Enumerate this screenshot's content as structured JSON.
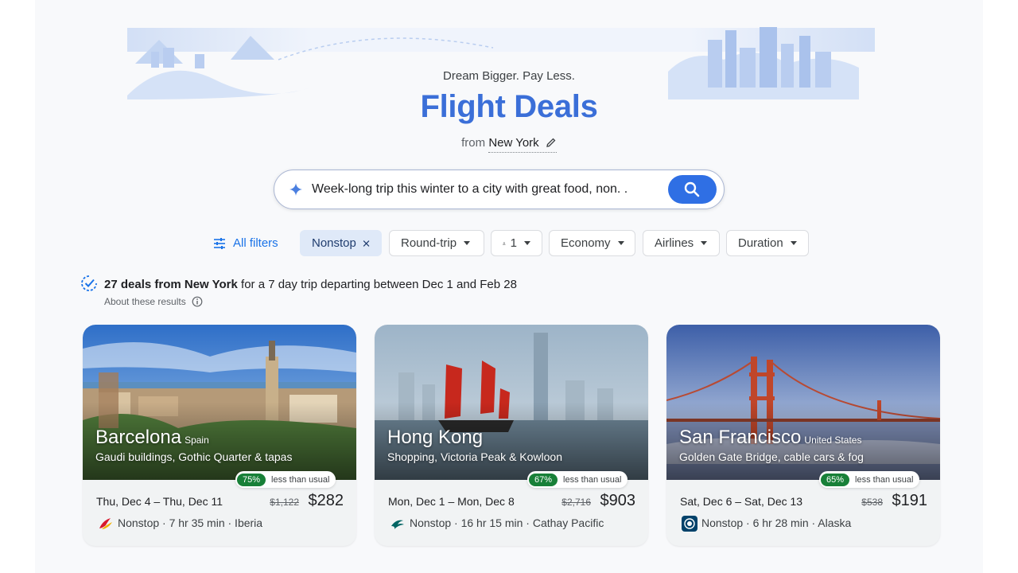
{
  "header": {
    "tagline": "Dream Bigger. Pay Less.",
    "title": "Flight Deals",
    "origin_prefix": "from",
    "origin_city": "New York"
  },
  "search": {
    "query": "Week-long trip this winter to a city with great food, non. ."
  },
  "filters": {
    "all_filters": "All filters",
    "nonstop": "Nonstop",
    "trip_type": "Round-trip",
    "passengers": "1",
    "cabin": "Economy",
    "airlines": "Airlines",
    "duration": "Duration"
  },
  "summary": {
    "count_text": "27 deals from New York",
    "detail_text": " for a 7 day trip departing between Dec 1 and Feb 28",
    "about": "About these results"
  },
  "colors": {
    "accent": "#2f6fe4",
    "title": "#3b6fd8",
    "deal_green": "#188038",
    "chip_selected": "#dfe9f8"
  },
  "deals": [
    {
      "city": "Barcelona",
      "country": "Spain",
      "description": "Gaudi buildings, Gothic Quarter & tapas",
      "discount": "75%",
      "discount_label": "less than usual",
      "dates": "Thu, Dec 4 – Thu, Dec 11",
      "old_price": "$1,122",
      "price": "$282",
      "flight": "Nonstop · 7 hr 35 min · Iberia",
      "airline_icon": "iberia-logo-icon"
    },
    {
      "city": "Hong Kong",
      "country": "",
      "description": "Shopping, Victoria Peak & Kowloon",
      "discount": "67%",
      "discount_label": "less than usual",
      "dates": "Mon, Dec 1 – Mon, Dec 8",
      "old_price": "$2,716",
      "price": "$903",
      "flight": "Nonstop · 16 hr 15 min · Cathay Pacific",
      "airline_icon": "cathay-pacific-logo-icon"
    },
    {
      "city": "San Francisco",
      "country": "United States",
      "description": "Golden Gate Bridge, cable cars & fog",
      "discount": "65%",
      "discount_label": "less than usual",
      "dates": "Sat, Dec 6 – Sat, Dec 13",
      "old_price": "$538",
      "price": "$191",
      "flight": "Nonstop · 6 hr 28 min · Alaska",
      "airline_icon": "alaska-airlines-logo-icon"
    }
  ]
}
